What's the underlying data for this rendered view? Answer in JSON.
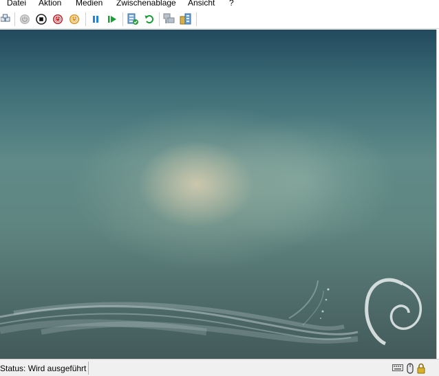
{
  "menu": {
    "items": [
      "Datei",
      "Aktion",
      "Medien",
      "Zwischenablage",
      "Ansicht",
      "?"
    ]
  },
  "toolbar": {
    "icons": [
      "ctrl-alt-del-icon",
      "start-icon",
      "turn-off-icon",
      "shut-down-icon",
      "power-icon",
      "pause-icon",
      "resume-icon",
      "checkpoint-icon",
      "revert-icon",
      "enhanced-session-icon",
      "share-icon"
    ]
  },
  "status": {
    "text": "Status: Wird ausgeführt"
  },
  "colors": {
    "desktop_top": "#234a5e",
    "desktop_bottom": "#425a5a",
    "status_bar": "#f0f0f0"
  }
}
